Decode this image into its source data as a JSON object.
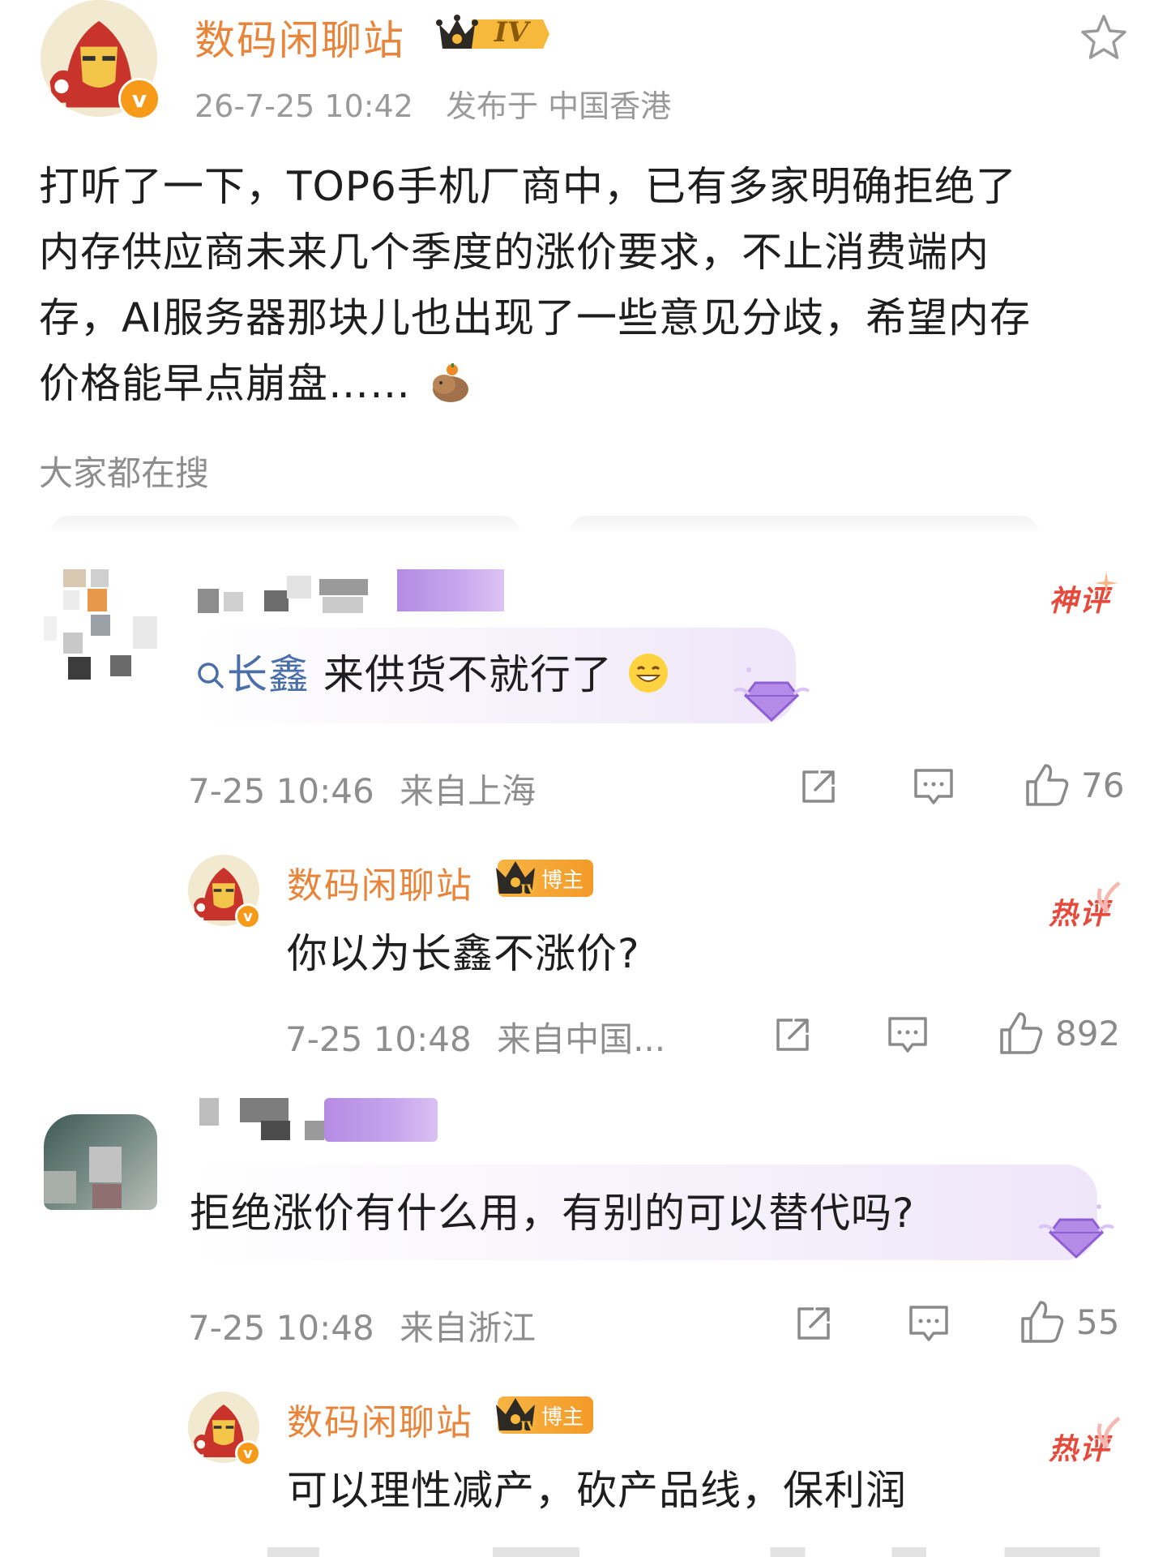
{
  "post": {
    "author": "数码闲聊站",
    "level_badge": "IV",
    "verified_mark": "v",
    "timestamp": "26-7-25 10:42",
    "location": "发布于 中国香港",
    "body_lines": [
      "打听了一下，TOP6手机厂商中，已有多家明确拒绝了",
      "内存供应商未来几个季度的涨价要求，不止消费端内",
      "存，AI服务器那块儿也出现了一些意见分歧，希望内存",
      "价格能早点崩盘……"
    ],
    "body_emoji": "capybara-emoji",
    "favorite_icon": "star-outline-icon"
  },
  "search_section": {
    "label": "大家都在搜"
  },
  "comments": [
    {
      "search_prefix": "长鑫",
      "text": " 来供货不就行了",
      "emoji": "grin-emoji",
      "tag": "神评",
      "time": "7-25 10:46",
      "location": "来自上海",
      "likes": "76",
      "reply": {
        "author": "数码闲聊站",
        "owner_label": "博主",
        "text": "你以为长鑫不涨价?",
        "tag": "热评",
        "time": "7-25 10:48",
        "location": "来自中国...",
        "likes": "892"
      }
    },
    {
      "text": "拒绝涨价有什么用，有别的可以替代吗?",
      "time": "7-25 10:48",
      "location": "来自浙江",
      "likes": "55",
      "reply": {
        "author": "数码闲聊站",
        "owner_label": "博主",
        "text": "可以理性减产，砍产品线，保利润",
        "tag": "热评"
      }
    }
  ],
  "colors": {
    "author": "#e8853a",
    "meta": "#9a9a9a",
    "link": "#4a6ea8",
    "hot_tag": "#e64a3c",
    "badge": "#f39a28"
  }
}
